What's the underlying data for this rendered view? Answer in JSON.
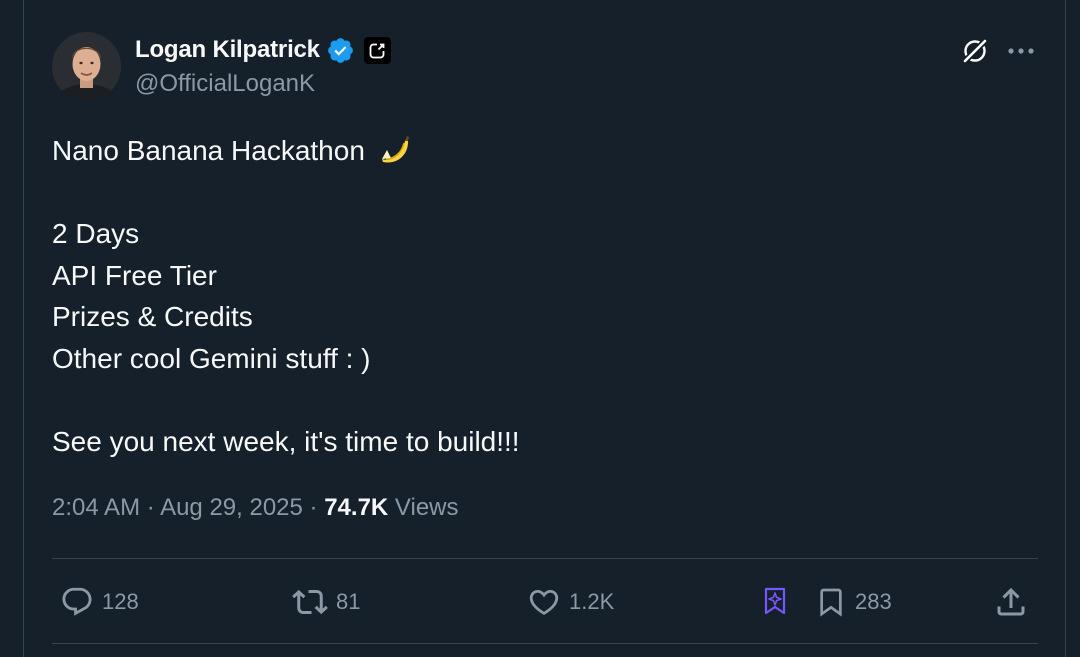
{
  "author": {
    "display_name": "Logan Kilpatrick",
    "handle": "@OfficialLoganK",
    "verified": true,
    "affiliate_badge_icon": "affiliate-badge-icon"
  },
  "header_actions": {
    "grok_icon": "grok-icon",
    "more_icon": "more-options-icon"
  },
  "tweet": {
    "lines": [
      "Nano Banana Hackathon",
      "",
      "2 Days",
      "API Free Tier",
      "Prizes & Credits",
      "Other cool Gemini stuff : )",
      "",
      "See you next week, it's time to build!!!"
    ],
    "emoji": "banana-emoji"
  },
  "meta": {
    "time": "2:04 AM",
    "separator": " · ",
    "date": "Aug 29, 2025",
    "views_count": "74.7K",
    "views_label": "Views"
  },
  "actions": {
    "reply_count": "128",
    "repost_count": "81",
    "like_count": "1.2K",
    "bookmark_count": "283"
  },
  "colors": {
    "background": "#15202b",
    "text": "#f7f9f9",
    "secondary": "#8b98a5",
    "verified_blue": "#1d9bf0",
    "grok_purple": "#7856ff",
    "border": "#38444d"
  }
}
